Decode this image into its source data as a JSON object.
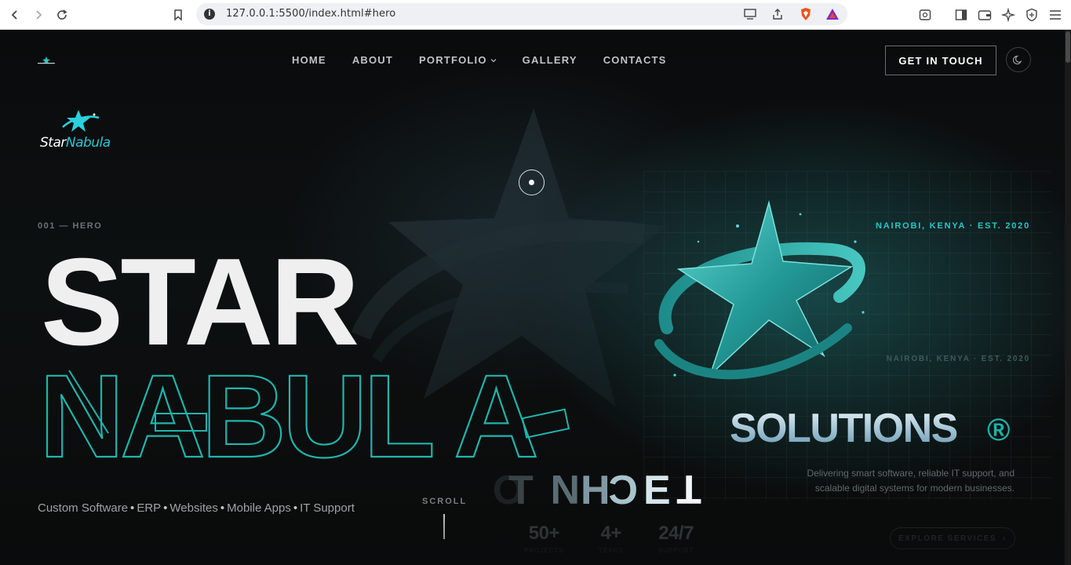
{
  "browser": {
    "url": "127.0.0.1:5500/index.html#hero"
  },
  "nav": {
    "items": [
      {
        "label": "HOME"
      },
      {
        "label": "ABOUT"
      },
      {
        "label": "PORTFOLIO"
      },
      {
        "label": "GALLERY"
      },
      {
        "label": "CONTACTS"
      }
    ],
    "cta_label": "GET IN TOUCH"
  },
  "brand": {
    "logo_text_main": "Star",
    "logo_text_accent": "Nabula"
  },
  "hero": {
    "section_tag": "001 — HERO",
    "title_line1": "STAR",
    "title_line2": "NABUL A",
    "location": "NAIROBI, KENYA · EST. 2020",
    "location_echo": "NAIROBI, KENYA · EST. 2020",
    "solutions": "SOLUTIONS",
    "registered": "®",
    "description": "Delivering smart software, reliable IT support, and scalable digital systems for modern businesses.",
    "explore_label": "EXPLORE SERVICES",
    "services": [
      "Custom Software",
      "ERP",
      "Websites",
      "Mobile Apps",
      "IT Support"
    ],
    "scroll_label": "SCROLL",
    "stats": [
      {
        "value": "50+",
        "label": "PROJECTS"
      },
      {
        "value": "4+",
        "label": "YEARS"
      },
      {
        "value": "24/7",
        "label": "SUPPORT"
      }
    ]
  },
  "colors": {
    "accent": "#29c7c6",
    "background": "#0b0d0e",
    "text": "#efefef"
  }
}
